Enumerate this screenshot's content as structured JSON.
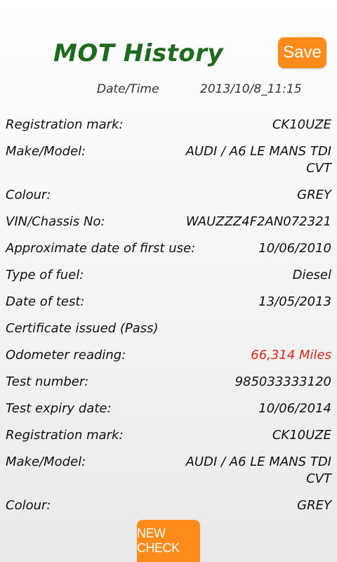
{
  "header": {
    "title": "MOT History",
    "save_label": "Save",
    "datetime_label": "Date/Time",
    "datetime_value": "2013/10/8_11:15"
  },
  "rows": [
    {
      "label": "Registration mark:",
      "value": "CK10UZE"
    },
    {
      "label": "Make/Model:",
      "value": "AUDI / A6 LE MANS TDI CVT"
    },
    {
      "label": "Colour:",
      "value": "GREY"
    },
    {
      "label": "VIN/Chassis No:",
      "value": "WAUZZZ4F2AN072321"
    },
    {
      "label": "Approximate date of first use:",
      "value": "10/06/2010"
    },
    {
      "label": "Type of fuel:",
      "value": "Diesel"
    },
    {
      "label": "Date of test:",
      "value": "13/05/2013"
    },
    {
      "label": "Certificate issued (Pass)",
      "value": ""
    },
    {
      "label": "Odometer reading:",
      "value": "66,314 Miles"
    },
    {
      "label": "Test number:",
      "value": "985033333120"
    },
    {
      "label": "Test expiry date:",
      "value": "10/06/2014"
    },
    {
      "label": "Registration mark:",
      "value": "CK10UZE"
    },
    {
      "label": "Make/Model:",
      "value": "AUDI / A6 LE MANS TDI CVT"
    },
    {
      "label": "Colour:",
      "value": "GREY"
    }
  ],
  "footer": {
    "new_check_label": "NEW CHECK"
  },
  "colors": {
    "title_green": "#1d6b1d",
    "button_orange": "#ff8c1a",
    "odometer_red": "#e0281b"
  }
}
